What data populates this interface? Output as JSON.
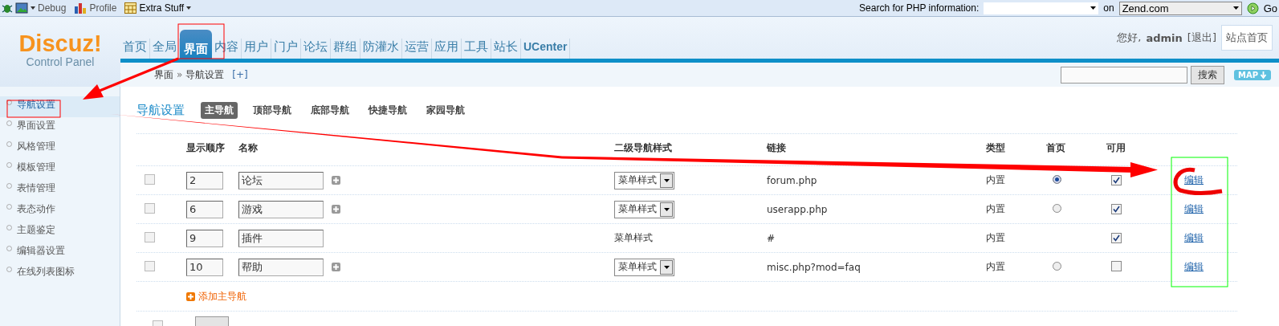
{
  "toolbar": {
    "items": [
      {
        "label": "Debug",
        "kind": "bug"
      },
      {
        "label": "Profile",
        "kind": "chart"
      },
      {
        "label": "Extra Stuff",
        "kind": "calendar"
      }
    ],
    "search_label": "Search for PHP information:",
    "on_label": "on",
    "site": "Zend.com",
    "go": "Go"
  },
  "header": {
    "logo": "Discuz!",
    "subtitle": "Control Panel",
    "nav": [
      {
        "label": "首页",
        "selected": false
      },
      {
        "label": "全局",
        "selected": false
      },
      {
        "label": "界面",
        "selected": true
      },
      {
        "label": "内容",
        "selected": false
      },
      {
        "label": "用户",
        "selected": false
      },
      {
        "label": "门户",
        "selected": false
      },
      {
        "label": "论坛",
        "selected": false
      },
      {
        "label": "群组",
        "selected": false
      },
      {
        "label": "防灌水",
        "selected": false
      },
      {
        "label": "运营",
        "selected": false
      },
      {
        "label": "应用",
        "selected": false
      },
      {
        "label": "工具",
        "selected": false
      },
      {
        "label": "站长",
        "selected": false
      },
      {
        "label": "UCenter",
        "selected": false
      }
    ],
    "greeting": "您好,",
    "user": "admin",
    "logout": "[退出]",
    "site_home": "站点首页"
  },
  "breadcrumb": {
    "items": [
      "界面",
      "导航设置"
    ],
    "separator": "»",
    "add": "[+]",
    "search_button": "搜索",
    "map": "MAP"
  },
  "sidebar": {
    "items": [
      {
        "label": "导航设置",
        "selected": true
      },
      {
        "label": "界面设置",
        "selected": false
      },
      {
        "label": "风格管理",
        "selected": false
      },
      {
        "label": "模板管理",
        "selected": false
      },
      {
        "label": "表情管理",
        "selected": false
      },
      {
        "label": "表态动作",
        "selected": false
      },
      {
        "label": "主题鉴定",
        "selected": false
      },
      {
        "label": "编辑器设置",
        "selected": false
      },
      {
        "label": "在线列表图标",
        "selected": false
      }
    ]
  },
  "page": {
    "title": "导航设置",
    "tabs": [
      {
        "label": "主导航",
        "selected": true
      },
      {
        "label": "顶部导航",
        "selected": false
      },
      {
        "label": "底部导航",
        "selected": false
      },
      {
        "label": "快捷导航",
        "selected": false
      },
      {
        "label": "家园导航",
        "selected": false
      }
    ]
  },
  "table": {
    "columns": [
      "显示顺序",
      "名称",
      "二级导航样式",
      "链接",
      "类型",
      "首页",
      "可用"
    ],
    "rows": [
      {
        "checked": false,
        "order": "2",
        "name": "论坛",
        "has_sub": true,
        "style": {
          "kind": "select",
          "value": "菜单样式"
        },
        "link": "forum.php",
        "type": "内置",
        "home": true,
        "enabled": true,
        "edit": "编辑"
      },
      {
        "checked": false,
        "order": "6",
        "name": "游戏",
        "has_sub": true,
        "style": {
          "kind": "select",
          "value": "菜单样式"
        },
        "link": "userapp.php",
        "type": "内置",
        "home": false,
        "enabled": true,
        "edit": "编辑"
      },
      {
        "checked": false,
        "order": "9",
        "name": "插件",
        "has_sub": false,
        "style": {
          "kind": "text",
          "value": "菜单样式"
        },
        "link": "#",
        "type": "内置",
        "enabled": true,
        "edit": "编辑"
      },
      {
        "checked": false,
        "order": "10",
        "name": "帮助",
        "has_sub": true,
        "style": {
          "kind": "select",
          "value": "菜单样式"
        },
        "link": "misc.php?mod=faq",
        "type": "内置",
        "home": false,
        "enabled": false,
        "edit": "编辑"
      }
    ],
    "add_link": "添加主导航"
  },
  "footer": {
    "delete_checked": false
  }
}
